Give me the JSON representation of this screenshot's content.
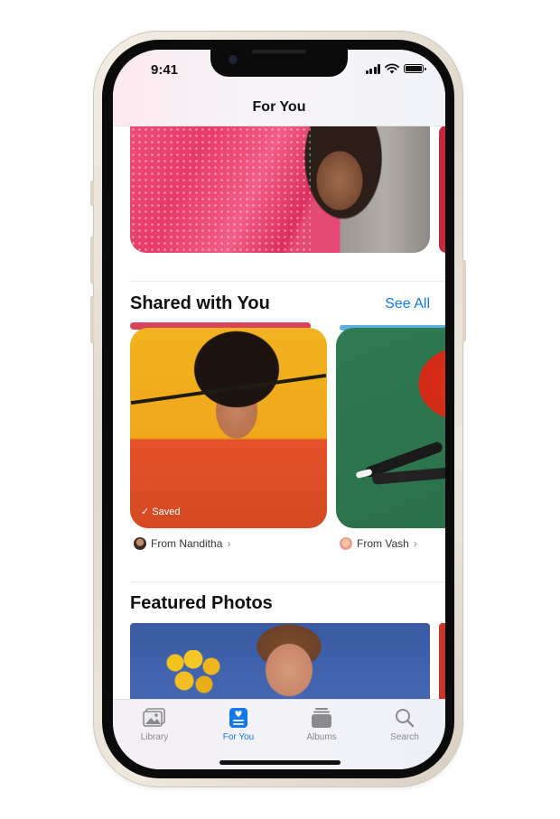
{
  "status_bar": {
    "time": "9:41"
  },
  "nav": {
    "title": "For You"
  },
  "shared_section": {
    "title": "Shared with You",
    "see_all": "See All",
    "cards": [
      {
        "badge": "Saved",
        "from": "From Nanditha"
      },
      {
        "from": "From Vash"
      }
    ]
  },
  "featured_section": {
    "title": "Featured Photos"
  },
  "tab_bar": {
    "tabs": [
      {
        "label": "Library",
        "icon": "photos-stack-icon",
        "active": false
      },
      {
        "label": "For You",
        "icon": "for-you-icon",
        "active": true
      },
      {
        "label": "Albums",
        "icon": "albums-icon",
        "active": false
      },
      {
        "label": "Search",
        "icon": "search-icon",
        "active": false
      }
    ]
  },
  "colors": {
    "accent": "#1478e6",
    "inactive": "#8a8a8e"
  }
}
